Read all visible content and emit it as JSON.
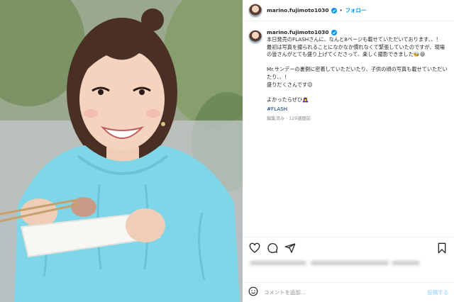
{
  "post": {
    "username": "marino.fujimoto1030",
    "dot": "•",
    "follow_label": "フォロー",
    "caption": "本日発売のFLASHさんに、なんと8ページも載せていただいております、、！\n最初は写真を撮られることになかなか慣れなくて緊張していたのですが、現場の皆さんがとても盛り上げてくださって、楽しく撮影できました🐝😆\n\nMr.サンデーの裏側に密着していただいたり、子供の頃の写真も載せていただいたり、、！\n盛りだくさんです😌\n\nよかったらぜひ🙇‍♀️",
    "hashtag": "#FLASH",
    "meta": "編集済み · 129週間前"
  },
  "comment": {
    "placeholder": "コメントを追加...",
    "post_label": "投稿する"
  },
  "icons": {
    "verified": "verified-badge-icon",
    "like": "heart-icon",
    "comment": "comment-icon",
    "share": "send-icon",
    "save": "bookmark-icon",
    "emoji": "smiley-icon"
  },
  "colors": {
    "accent": "#0095f6",
    "hashtag": "#00376b",
    "muted": "#8e8e8e",
    "post_disabled": "#b2dffc",
    "dress": "#7fd6e8"
  }
}
